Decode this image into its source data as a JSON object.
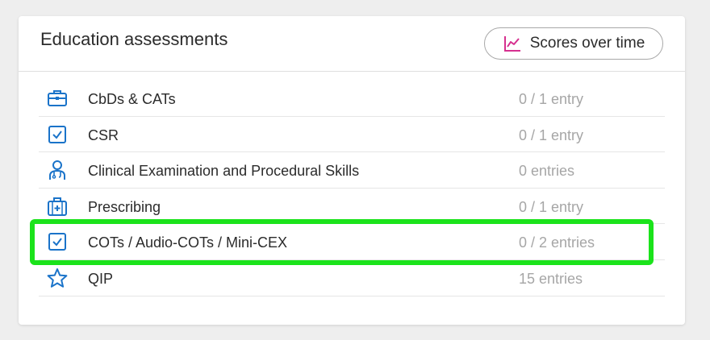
{
  "card": {
    "title": "Education assessments",
    "scores_button": {
      "label": "Scores over time",
      "icon": "line-chart-icon",
      "icon_color": "#d6308f"
    }
  },
  "accent_color": "#1a73c9",
  "highlight_color": "#1be31b",
  "items": [
    {
      "label": "CbDs & CATs",
      "count": "0 / 1 entry",
      "icon": "briefcase-icon"
    },
    {
      "label": "CSR",
      "count": "0 / 1 entry",
      "icon": "checkbox-icon"
    },
    {
      "label": "Clinical Examination and Procedural Skills",
      "count": "0 entries",
      "icon": "doctor-icon"
    },
    {
      "label": "Prescribing",
      "count": "0 / 1 entry",
      "icon": "medical-kit-icon"
    },
    {
      "label": "COTs / Audio-COTs / Mini-CEX",
      "count": "0 / 2 entries",
      "icon": "checkbox-icon",
      "highlighted": true
    },
    {
      "label": "QIP",
      "count": "15 entries",
      "icon": "star-icon"
    }
  ]
}
